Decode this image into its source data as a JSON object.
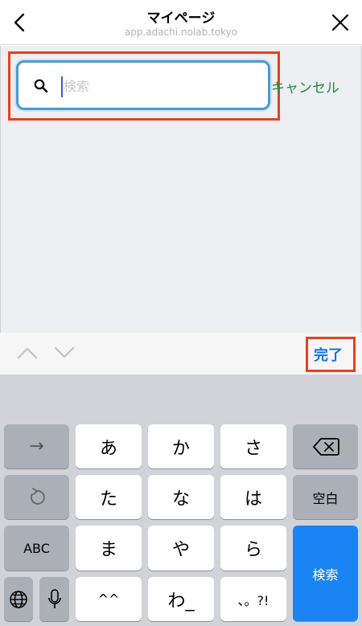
{
  "header": {
    "title": "マイページ",
    "subtitle": "app.adachi.nolab.tokyo",
    "back_icon": "chevron-left-icon",
    "close_icon": "close-icon"
  },
  "search": {
    "placeholder": "検索",
    "value": "",
    "cancel_label": "キャンセル"
  },
  "accessory": {
    "done_label": "完了"
  },
  "keyboard": {
    "row1": [
      "→",
      "あ",
      "か",
      "さ",
      "⌫"
    ],
    "row2": [
      "↺",
      "た",
      "な",
      "は",
      "空白"
    ],
    "row3": [
      "ABC",
      "ま",
      "や",
      "ら"
    ],
    "row4": [
      "🌐",
      "🎤",
      "^^",
      "わ_",
      "、。?!"
    ],
    "action_label": "検索"
  },
  "colors": {
    "accent_blue": "#1a84f4",
    "cancel_green": "#1e8a3d",
    "highlight_red": "#e8401f"
  }
}
